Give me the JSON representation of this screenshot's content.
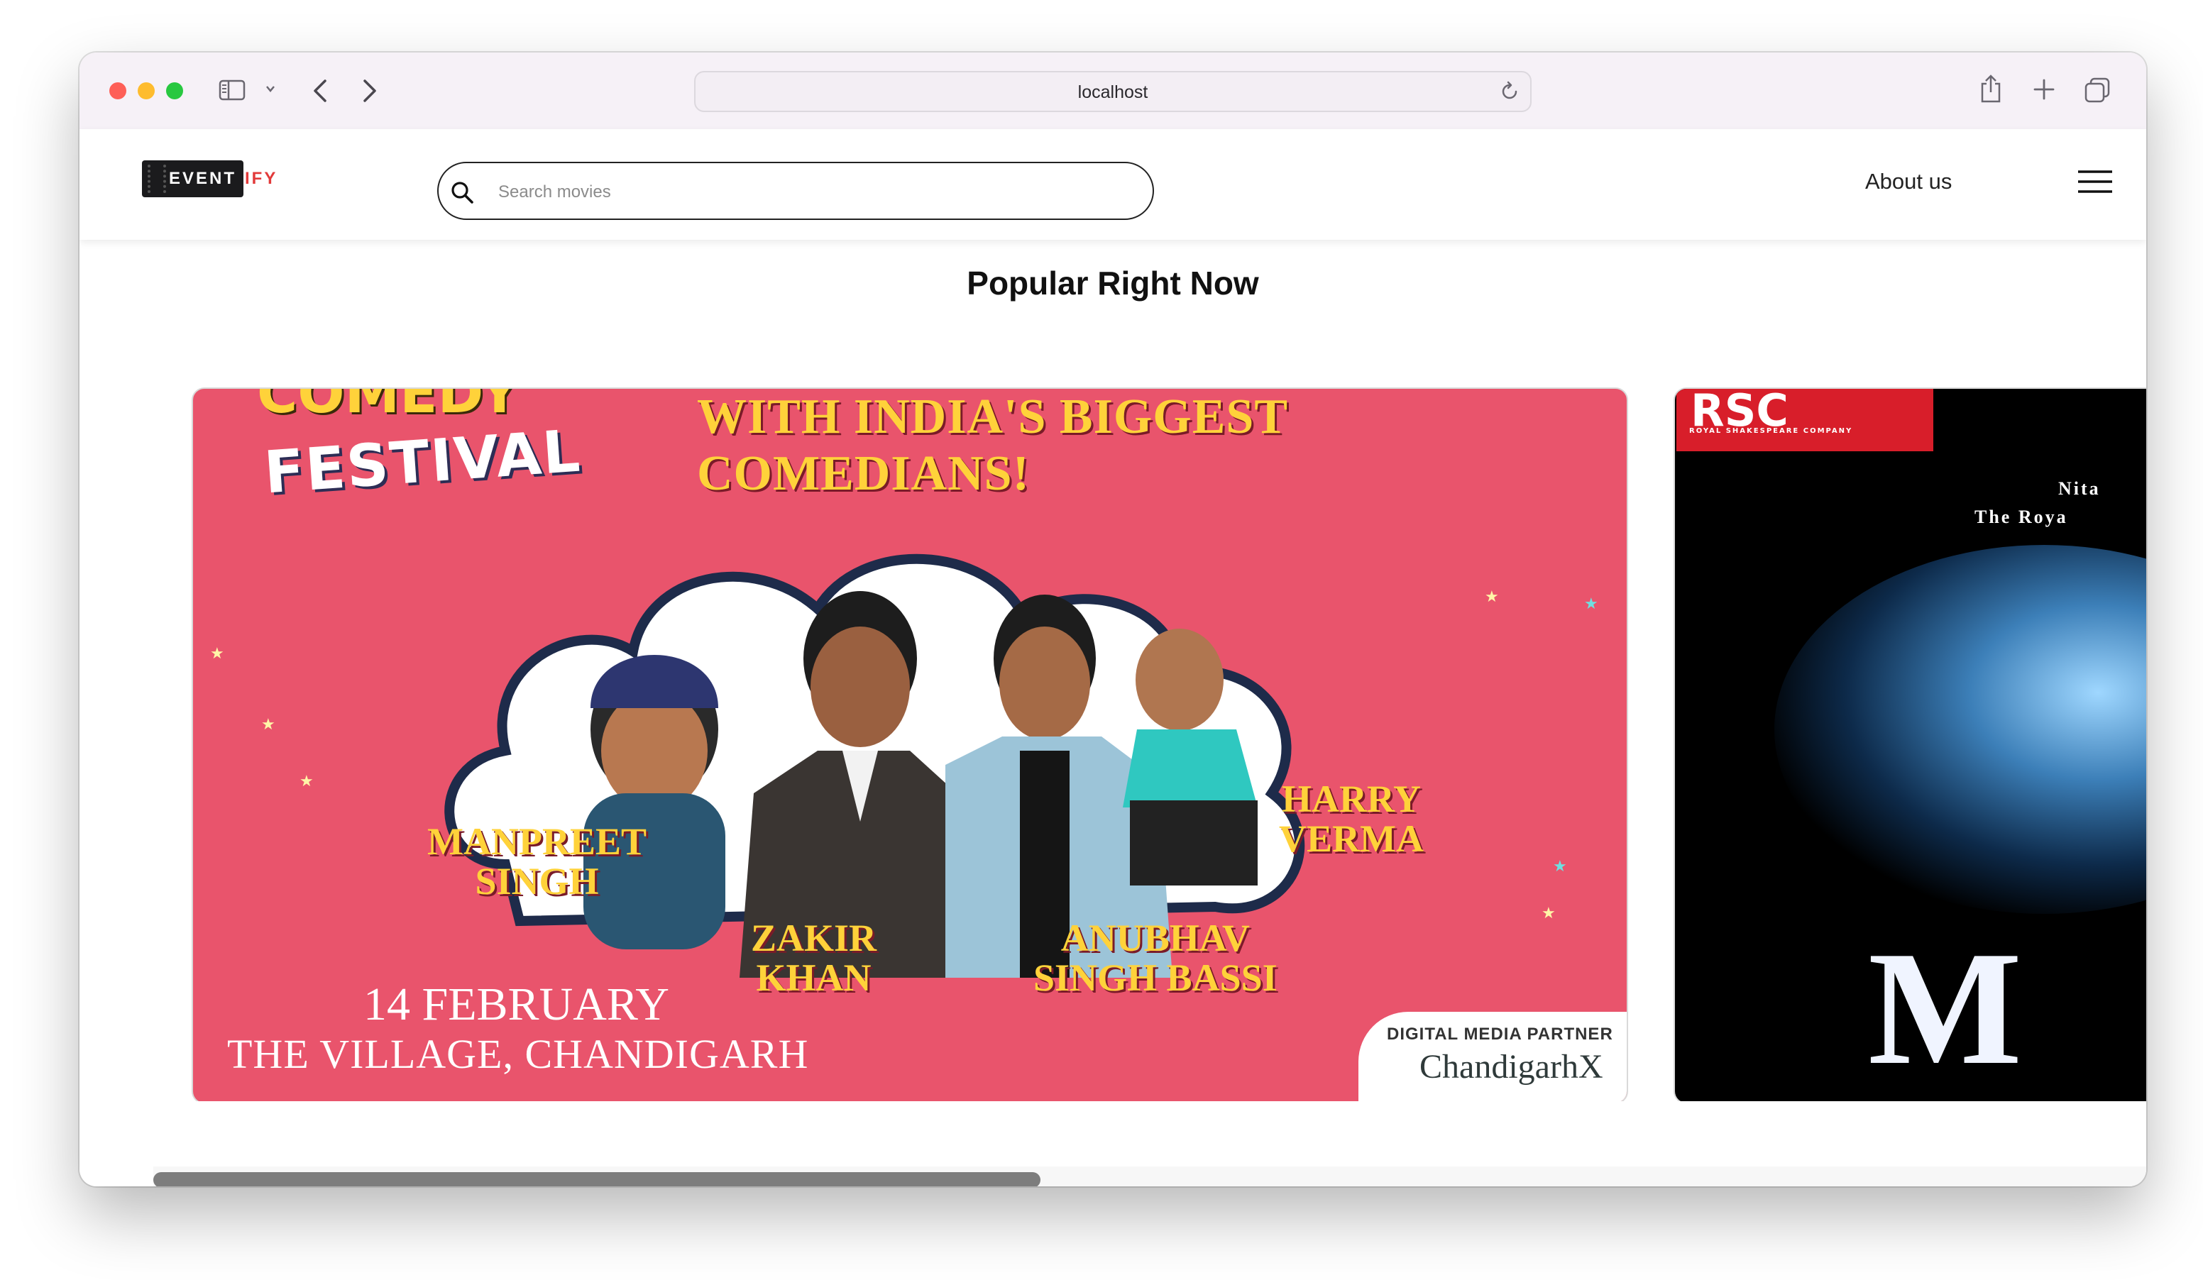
{
  "browser": {
    "url": "localhost"
  },
  "navbar": {
    "logo": {
      "part1": "EVENT",
      "part2": "IFY"
    },
    "search": {
      "placeholder": "Search movies",
      "value": ""
    },
    "about_label": "About us"
  },
  "section": {
    "title": "Popular Right Now"
  },
  "cards": [
    {
      "headline": "WITH INDIA'S BIGGEST COMEDIANS!",
      "brand_top": "COMEDY",
      "brand": "FESTIVAL",
      "names": [
        [
          "MANPREET",
          "SINGH"
        ],
        [
          "ZAKIR",
          "KHAN"
        ],
        [
          "ANUBHAV",
          "SINGH BASSI"
        ],
        [
          "HARRY",
          "VERMA"
        ]
      ],
      "date": "14 FEBRUARY",
      "venue": "THE VILLAGE, CHANDIGARH",
      "partner_label": "DIGITAL MEDIA PARTNER",
      "partner_name": "ChandigarhX"
    },
    {
      "badge": "RSC",
      "badge_sub": "ROYAL SHAKESPEARE COMPANY",
      "line1": "Nita",
      "line2": "The Roya",
      "big_letter": "M"
    }
  ],
  "colors": {
    "card1_bg": "#e9546c",
    "headline_yellow": "#ffd23a",
    "rsc_red": "#d81e2a"
  }
}
